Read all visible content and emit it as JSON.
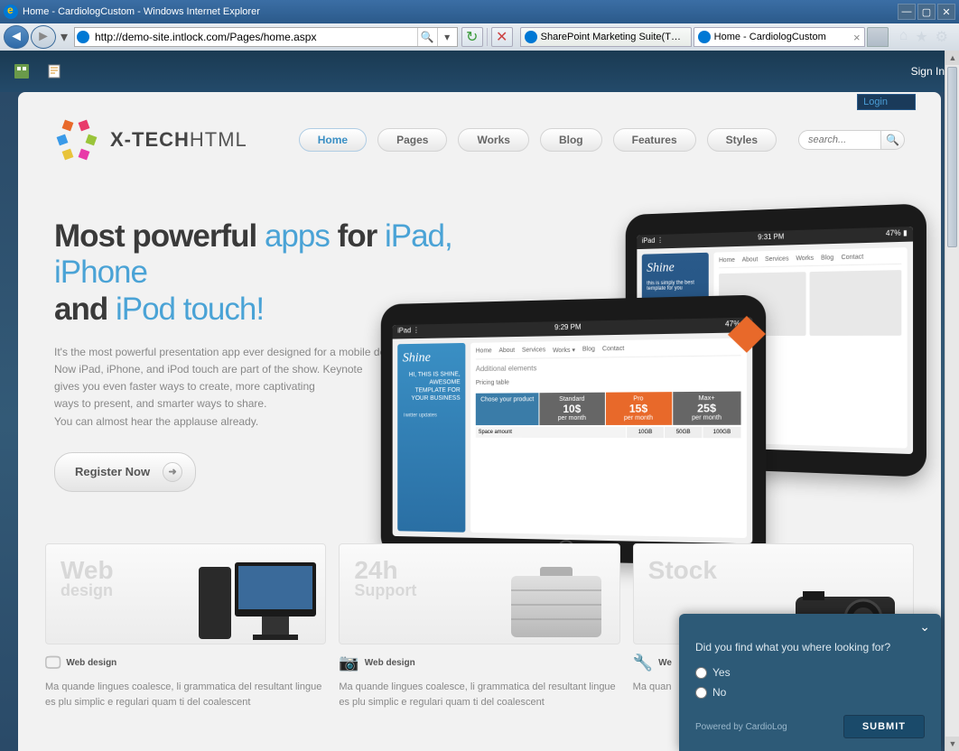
{
  "window": {
    "title": "Home - CardiologCustom - Windows Internet Explorer"
  },
  "toolbar": {
    "url": "http://demo-site.intlock.com/Pages/home.aspx",
    "tabs": [
      {
        "label": "SharePoint Marketing Suite(TM) ..."
      },
      {
        "label": "Home - CardiologCustom"
      }
    ]
  },
  "sp": {
    "signin": "Sign In",
    "login": "Login"
  },
  "logo": {
    "bold": "X-TECH",
    "light": "HTML"
  },
  "nav": {
    "items": [
      "Home",
      "Pages",
      "Works",
      "Blog",
      "Features",
      "Styles"
    ],
    "search_placeholder": "search..."
  },
  "hero": {
    "h1_p1": "Most powerful ",
    "h1_p2": "apps",
    "h1_p3": " for ",
    "h1_p4": "iPad, iPhone",
    "h1_p5": "and ",
    "h1_p6": "iPod touch!",
    "desc": "It's the most powerful presentation app ever designed for a mobile device.\nNow iPad, iPhone, and iPod touch are part of the show. Keynote\ngives you even faster ways to create, more captivating\nways to present, and smarter ways to share.\nYou can almost hear the applause already.",
    "register": "Register Now",
    "tablet_time1": "9:31 PM",
    "tablet_time2": "9:29 PM",
    "shine": "Shine",
    "side_text": "HI, THIS IS SHINE, AWESOME TEMPLATE FOR YOUR BUSINESS",
    "tnav": [
      "Home",
      "About",
      "Services",
      "Works ▾",
      "Blog",
      "Contact"
    ],
    "addl": "Additional elements",
    "ptable": "Pricing table",
    "pcols": [
      {
        "h": "Chose your product",
        "p": ""
      },
      {
        "h": "Standard",
        "p": "10$",
        "s": "per month"
      },
      {
        "h": "Pro",
        "p": "15$",
        "s": "per month"
      },
      {
        "h": "Max+",
        "p": "25$",
        "s": "per month"
      }
    ]
  },
  "features": {
    "boxes": [
      {
        "t1": "Web",
        "t2": "design"
      },
      {
        "t1": "24h",
        "t2": "Support"
      },
      {
        "t1": "Stock",
        "t2": ""
      }
    ],
    "meta": [
      {
        "label": "Web design",
        "text": "Ma quande lingues coalesce, li grammatica del resultant lingue es plu simplic e regulari quam ti del coalescent"
      },
      {
        "label": "Web design",
        "text": "Ma quande lingues coalesce, li grammatica del resultant lingue es plu simplic e regulari quam ti del coalescent"
      },
      {
        "label": "We",
        "text": "Ma quan"
      }
    ]
  },
  "survey": {
    "question": "Did you find what you where looking for?",
    "opt_yes": "Yes",
    "opt_no": "No",
    "powered": "Powered by CardioLog",
    "submit": "SUBMIT"
  }
}
